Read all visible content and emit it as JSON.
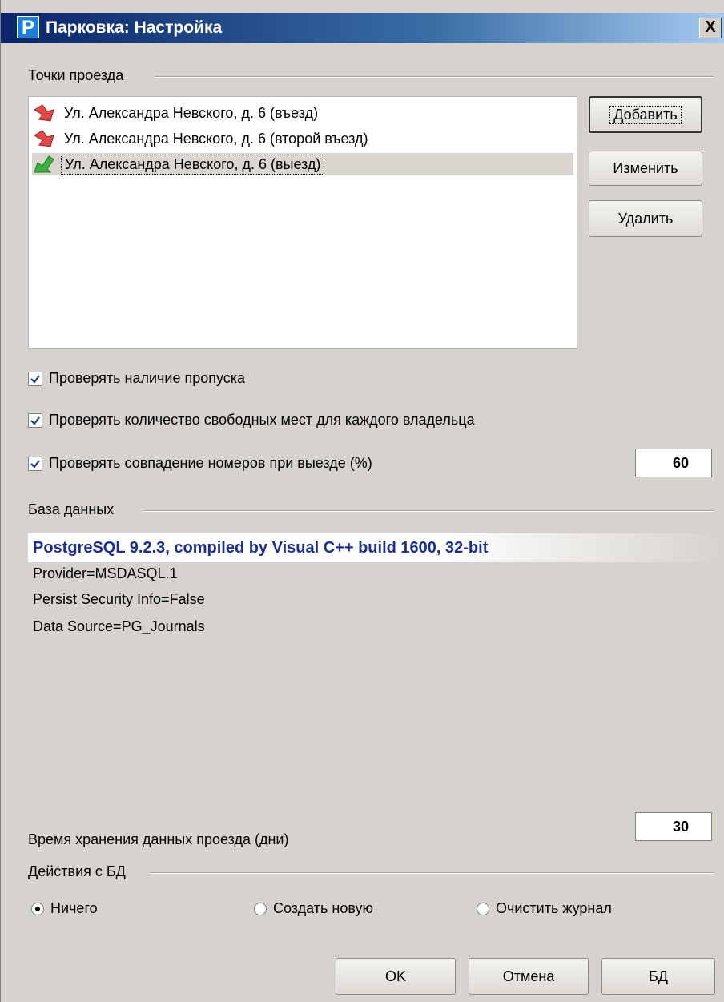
{
  "window": {
    "title": "Парковка: Настройка",
    "app_icon": "P",
    "close_glyph": "X"
  },
  "passage_points": {
    "label": "Точки проезда",
    "items": [
      {
        "text": "Ул. Александра Невского, д. 6 (въезд)",
        "icon": "entry-arrow-icon",
        "selected": false
      },
      {
        "text": "Ул. Александра Невского, д. 6 (второй въезд)",
        "icon": "entry-arrow-icon",
        "selected": false
      },
      {
        "text": "Ул. Александра Невского, д. 6 (выезд)",
        "icon": "exit-arrow-icon",
        "selected": true
      }
    ],
    "buttons": {
      "add": "Добавить",
      "edit": "Изменить",
      "delete": "Удалить"
    }
  },
  "checks": [
    {
      "label": "Проверять наличие пропуска",
      "checked": true
    },
    {
      "label": "Проверять количество свободных мест для каждого владельца",
      "checked": true
    },
    {
      "label": "Проверять совпадение номеров при выезде (%)",
      "checked": true
    }
  ],
  "match_percent": "60",
  "database": {
    "label": "База данных",
    "title": "PostgreSQL 9.2.3, compiled by Visual C++ build 1600, 32-bit",
    "lines": [
      "Provider=MSDASQL.1",
      "Persist Security Info=False",
      "Data Source=PG_Journals"
    ]
  },
  "retention": {
    "label": "Время хранения данных проезда (дни)",
    "value": "30"
  },
  "db_actions": {
    "label": "Действия с БД",
    "options": [
      {
        "label": "Ничего",
        "selected": true
      },
      {
        "label": "Создать новую",
        "selected": false
      },
      {
        "label": "Очистить журнал",
        "selected": false
      }
    ]
  },
  "footer": {
    "ok": "OK",
    "cancel": "Отмена",
    "db": "БД"
  },
  "colors": {
    "entry_arrow": "#e04848",
    "exit_arrow": "#3cb043",
    "db_title": "#1c2f8f",
    "titlebar": "#0a246a"
  }
}
